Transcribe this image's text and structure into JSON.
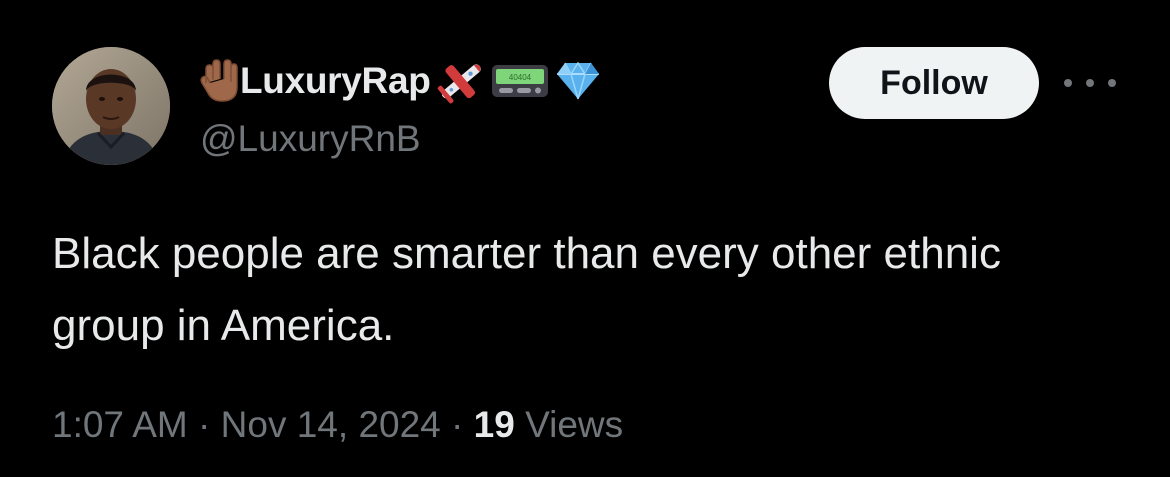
{
  "user": {
    "display_name": "LuxuryRap",
    "handle": "@LuxuryRnB",
    "pager_text": "40404",
    "name_emojis": [
      "vulcan-salute-icon",
      "airplane-icon",
      "pager-icon",
      "gem-icon"
    ]
  },
  "actions": {
    "follow_label": "Follow",
    "more_label": "···"
  },
  "tweet": {
    "text": "Black people are smarter than every other ethnic group in America."
  },
  "meta": {
    "time": "1:07 AM",
    "separator": "·",
    "date": "Nov 14, 2024",
    "views_count": "19",
    "views_label": "Views"
  },
  "colors": {
    "background": "#000000",
    "primary_text": "#e7e9ea",
    "secondary_text": "#71767b",
    "follow_button_bg": "#eff3f4",
    "follow_button_text": "#0f1419"
  }
}
